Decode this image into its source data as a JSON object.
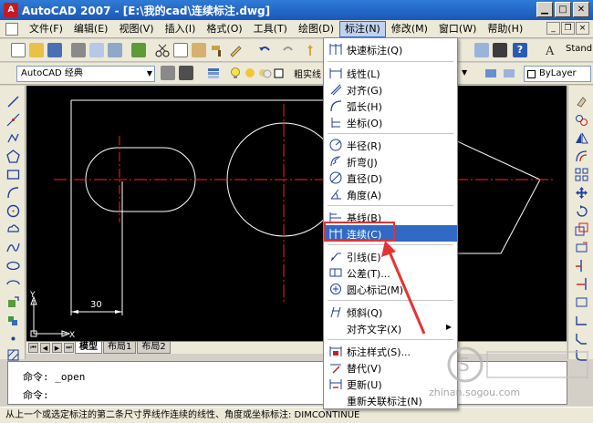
{
  "window": {
    "title": "AutoCAD 2007 - [E:\\我的cad\\连续标注.dwg]",
    "app_icon_letter": "A",
    "buttons": [
      "minimize",
      "maximize",
      "close"
    ]
  },
  "menubar": {
    "items": [
      {
        "label": "文件(F)"
      },
      {
        "label": "编辑(E)"
      },
      {
        "label": "视图(V)"
      },
      {
        "label": "插入(I)"
      },
      {
        "label": "格式(O)"
      },
      {
        "label": "工具(T)"
      },
      {
        "label": "绘图(D)"
      },
      {
        "label": "标注(N)",
        "active": true
      },
      {
        "label": "修改(M)"
      },
      {
        "label": "窗口(W)"
      },
      {
        "label": "帮助(H)"
      }
    ]
  },
  "toolbar": {
    "workspace": "AutoCAD 经典",
    "layer_text": "粗实线",
    "linetype": "ByLayer",
    "text_style": "Stand"
  },
  "dimension_menu": {
    "items": [
      {
        "label": "快速标注(Q)",
        "icon": "quick-dim-icon"
      },
      {
        "label": "线性(L)",
        "icon": "linear-dim-icon"
      },
      {
        "label": "对齐(G)",
        "icon": "aligned-dim-icon"
      },
      {
        "label": "弧长(H)",
        "icon": "arc-length-icon"
      },
      {
        "label": "坐标(O)",
        "icon": "ordinate-icon"
      },
      {
        "label": "半径(R)",
        "icon": "radius-icon"
      },
      {
        "label": "折弯(J)",
        "icon": "jogged-icon"
      },
      {
        "label": "直径(D)",
        "icon": "diameter-icon"
      },
      {
        "label": "角度(A)",
        "icon": "angular-icon"
      },
      {
        "label": "基线(B)",
        "icon": "baseline-icon"
      },
      {
        "label": "连续(C)",
        "icon": "continue-icon",
        "highlighted": true
      },
      {
        "label": "引线(E)",
        "icon": "leader-icon"
      },
      {
        "label": "公差(T)...",
        "icon": "tolerance-icon"
      },
      {
        "label": "圆心标记(M)",
        "icon": "center-mark-icon"
      },
      {
        "label": "倾斜(Q)",
        "icon": "oblique-icon"
      },
      {
        "label": "对齐文字(X)",
        "icon": "",
        "submenu": true
      },
      {
        "label": "标注样式(S)...",
        "icon": "dim-style-icon"
      },
      {
        "label": "替代(V)",
        "icon": "override-icon"
      },
      {
        "label": "更新(U)",
        "icon": "update-icon"
      },
      {
        "label": "重新关联标注(N)",
        "icon": ""
      }
    ]
  },
  "drawing": {
    "dimension_text": "30",
    "ucs_y": "Y",
    "ucs_x": "X"
  },
  "layout_tabs": [
    "模型",
    "布局1",
    "布局2"
  ],
  "command": {
    "line1": "命令: _open",
    "line2": "命令:"
  },
  "status_text": "从上一个或选定标注的第二条尺寸界线作连续的线性、角度或坐标标注:  DIMCONTINUE",
  "watermark": {
    "text": "zhinan.sogou.com"
  },
  "colors": {
    "title_bar": "#1b57b8",
    "menu_highlight": "#316ac5",
    "annotation": "#e53333",
    "centerline": "#ff2020",
    "canvas": "#000000"
  }
}
